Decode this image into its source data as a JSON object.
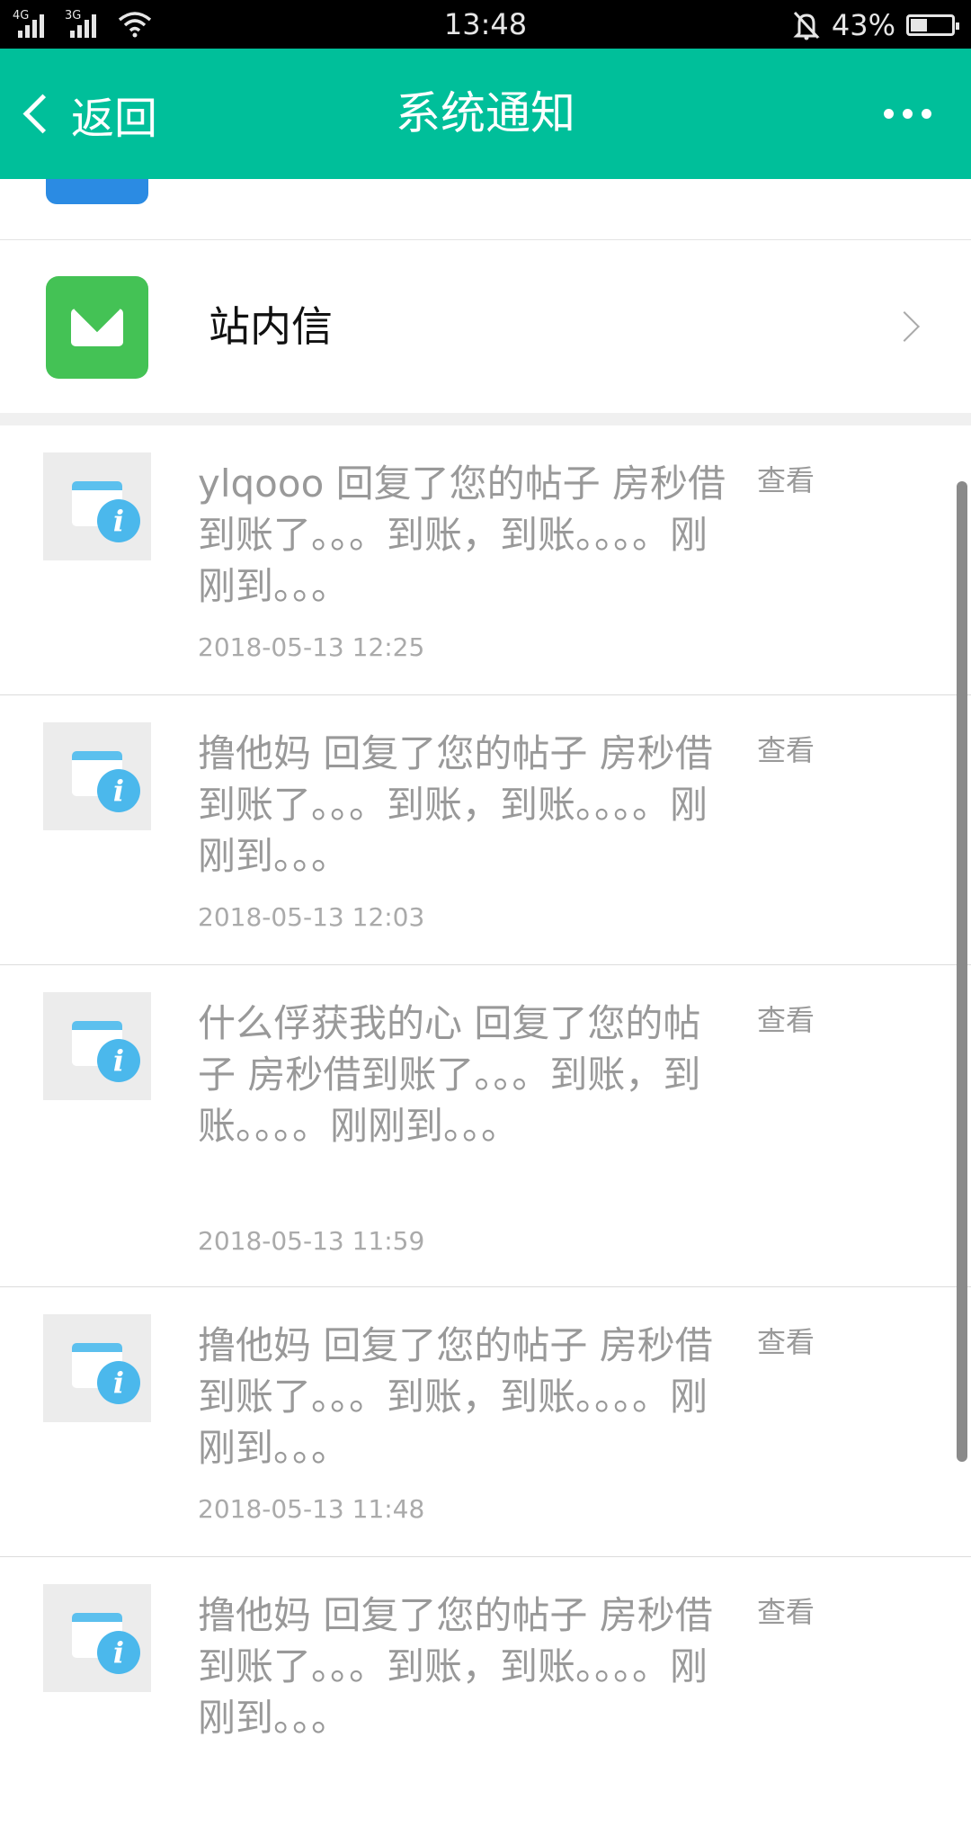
{
  "status_bar": {
    "time": "13:48",
    "battery": "43%",
    "network1": "4G",
    "network2": "3G",
    "icons": [
      "signal-icon",
      "signal-icon",
      "wifi-icon",
      "alarm-off-icon",
      "battery-icon"
    ]
  },
  "header": {
    "back_label": "返回",
    "title": "系统通知",
    "more_icon": "more-icon",
    "background": "#00bf9a"
  },
  "inbox": {
    "label": "站内信",
    "icon": "mail-icon",
    "icon_color": "#44c255"
  },
  "notifications": [
    {
      "message": "ylqooo 回复了您的帖子 房秒借到账了。。。到账，到账。。。。刚刚到。。。",
      "time": "2018-05-13 12:25",
      "action": "查看"
    },
    {
      "message": "撸他妈 回复了您的帖子 房秒借到账了。。。到账，到账。。。。刚刚到。。。",
      "time": "2018-05-13 12:03",
      "action": "查看"
    },
    {
      "message": "什么俘获我的心 回复了您的帖子 房秒借到账了。。。到账，到账。。。。刚刚到。。。",
      "time": "2018-05-13 11:59",
      "action": "查看"
    },
    {
      "message": "撸他妈 回复了您的帖子 房秒借到账了。。。到账，到账。。。。刚刚到。。。",
      "time": "2018-05-13 11:48",
      "action": "查看"
    },
    {
      "message": "撸他妈 回复了您的帖子 房秒借到账了。。。到账，到账。。。。刚刚到。。。",
      "time": "",
      "action": "查看"
    }
  ]
}
